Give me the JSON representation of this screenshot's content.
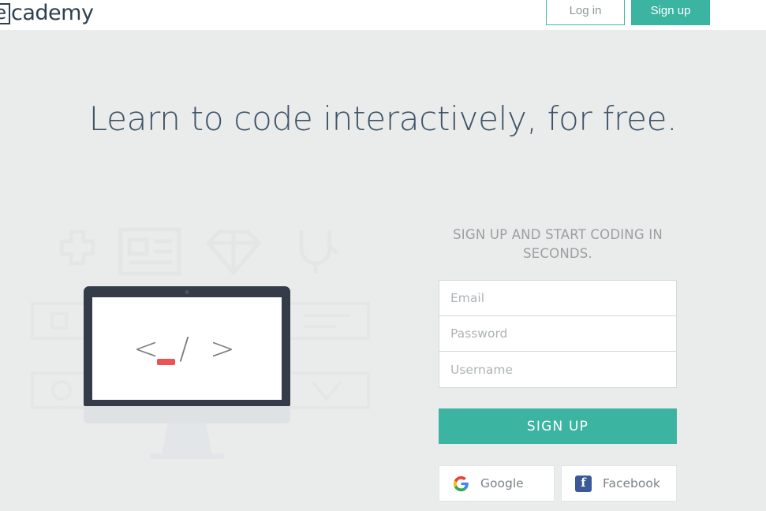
{
  "brand": {
    "logo_boxed_letter": "e",
    "logo_rest": "cademy"
  },
  "header": {
    "login_label": "Log in",
    "signup_label": "Sign up"
  },
  "hero": {
    "headline": "Learn to code interactively, for free."
  },
  "illustration": {
    "code_symbol": "< / >",
    "ghost_icons": [
      "puzzle-icon",
      "article-icon",
      "gem-icon",
      "plug-icon",
      "tag-icon",
      "badge-icon",
      "box-icon",
      "ribbon-icon"
    ]
  },
  "signup": {
    "title": "SIGN UP AND START CODING IN SECONDS.",
    "fields": [
      {
        "name": "email",
        "placeholder": "Email",
        "value": "",
        "type": "text"
      },
      {
        "name": "password",
        "placeholder": "Password",
        "value": "",
        "type": "password"
      },
      {
        "name": "username",
        "placeholder": "Username",
        "value": "",
        "type": "text"
      }
    ],
    "submit_label": "SIGN UP",
    "social": [
      {
        "provider": "google",
        "label": "Google"
      },
      {
        "provider": "facebook",
        "label": "Facebook",
        "glyph": "f"
      }
    ]
  },
  "colors": {
    "page_bg": "#eaebeb",
    "header_bg": "#ffffff",
    "teal": "#3bb4a1",
    "teal_border": "#3ab7a3",
    "headline": "#3e5366",
    "muted_text": "#9aa0a3",
    "placeholder": "#aeb3b6",
    "monitor_bezel": "#343b49",
    "accent_red": "#ee5353",
    "facebook_blue": "#3b5998"
  }
}
